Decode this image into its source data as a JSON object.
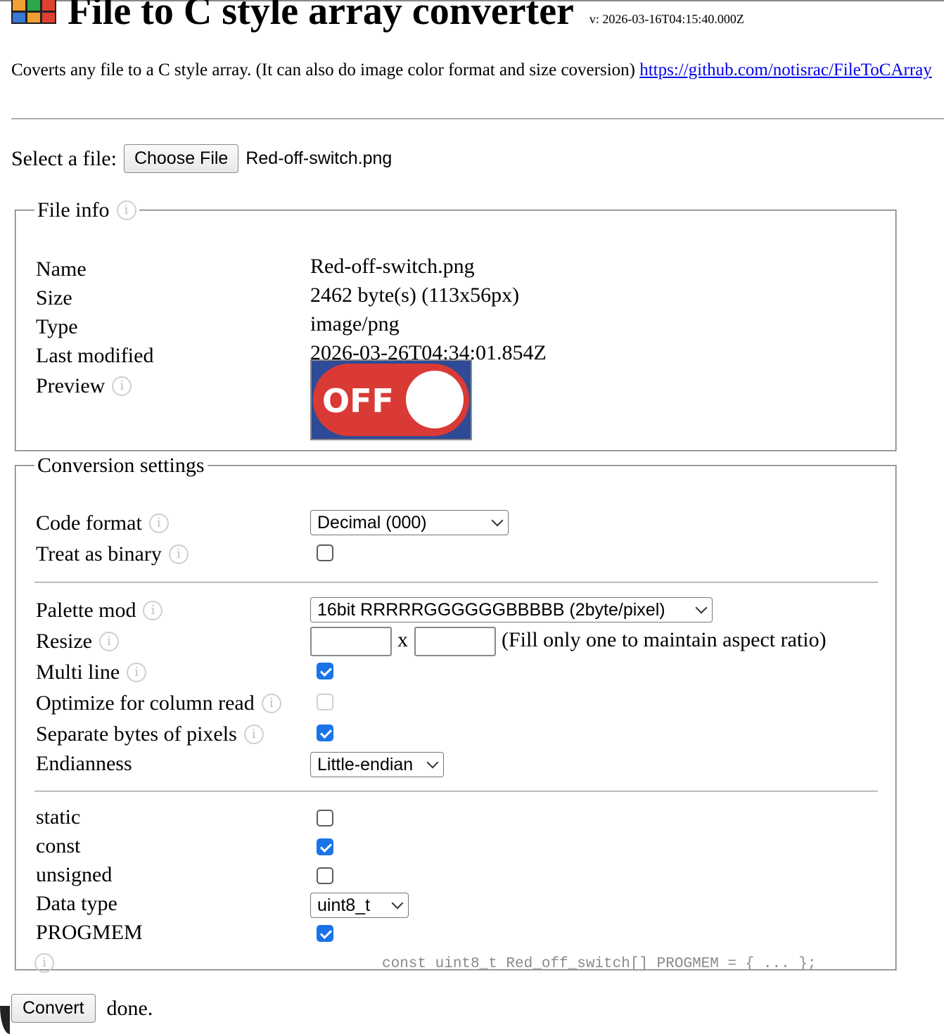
{
  "header": {
    "title": "File to C style array converter",
    "version": "v: 2026-03-16T04:15:40.000Z",
    "logo_colors": [
      "#f0a030",
      "#2aa84a",
      "#e04030",
      "#3a78d8",
      "#f0a030",
      "#e04030"
    ]
  },
  "description": {
    "text": "Coverts any file to a C style array. (It can also do image color format and size coversion)",
    "link": "https://github.com/notisrac/FileToCArray"
  },
  "file_select": {
    "label": "Select a file:",
    "button": "Choose File",
    "chosen": "Red-off-switch.png"
  },
  "file_info": {
    "legend": "File info",
    "rows": [
      {
        "label": "Name",
        "value": "Red-off-switch.png"
      },
      {
        "label": "Size",
        "value": "2462 byte(s) (113x56px)"
      },
      {
        "label": "Type",
        "value": "image/png"
      },
      {
        "label": "Last modified",
        "value": "2026-03-26T04:34:01.854Z"
      }
    ],
    "preview_label": "Preview",
    "preview_text": "OFF",
    "preview_colors": {
      "background": "#2f4a96",
      "pill": "#d93a35",
      "knob": "#ffffff"
    }
  },
  "settings": {
    "legend": "Conversion settings",
    "code_format": {
      "label": "Code format",
      "value": "Decimal (000)"
    },
    "treat_binary": {
      "label": "Treat as binary",
      "checked": false
    },
    "palette_mod": {
      "label": "Palette mod",
      "value": "16bit RRRRRGGGGGGBBBBB (2byte/pixel)"
    },
    "resize": {
      "label": "Resize",
      "width": "",
      "height": "",
      "separator": "x",
      "hint": "(Fill only one to maintain aspect ratio)"
    },
    "multi_line": {
      "label": "Multi line",
      "checked": true
    },
    "optimize_column": {
      "label": "Optimize for column read",
      "checked": false,
      "disabled": true
    },
    "separate_bytes": {
      "label": "Separate bytes of pixels",
      "checked": true
    },
    "endianness": {
      "label": "Endianness",
      "value": "Little-endian"
    },
    "static": {
      "label": "static",
      "checked": false
    },
    "const": {
      "label": "const",
      "checked": true
    },
    "unsigned": {
      "label": "unsigned",
      "checked": false
    },
    "data_type": {
      "label": "Data type",
      "value": "uint8_t"
    },
    "progmem": {
      "label": "PROGMEM",
      "checked": true
    },
    "code_preview": "const uint8_t Red_off_switch[] PROGMEM = { ... };"
  },
  "actions": {
    "convert": "Convert",
    "status": "done."
  },
  "colors": {
    "accent": "#1a73e8",
    "link": "#0000ee"
  }
}
